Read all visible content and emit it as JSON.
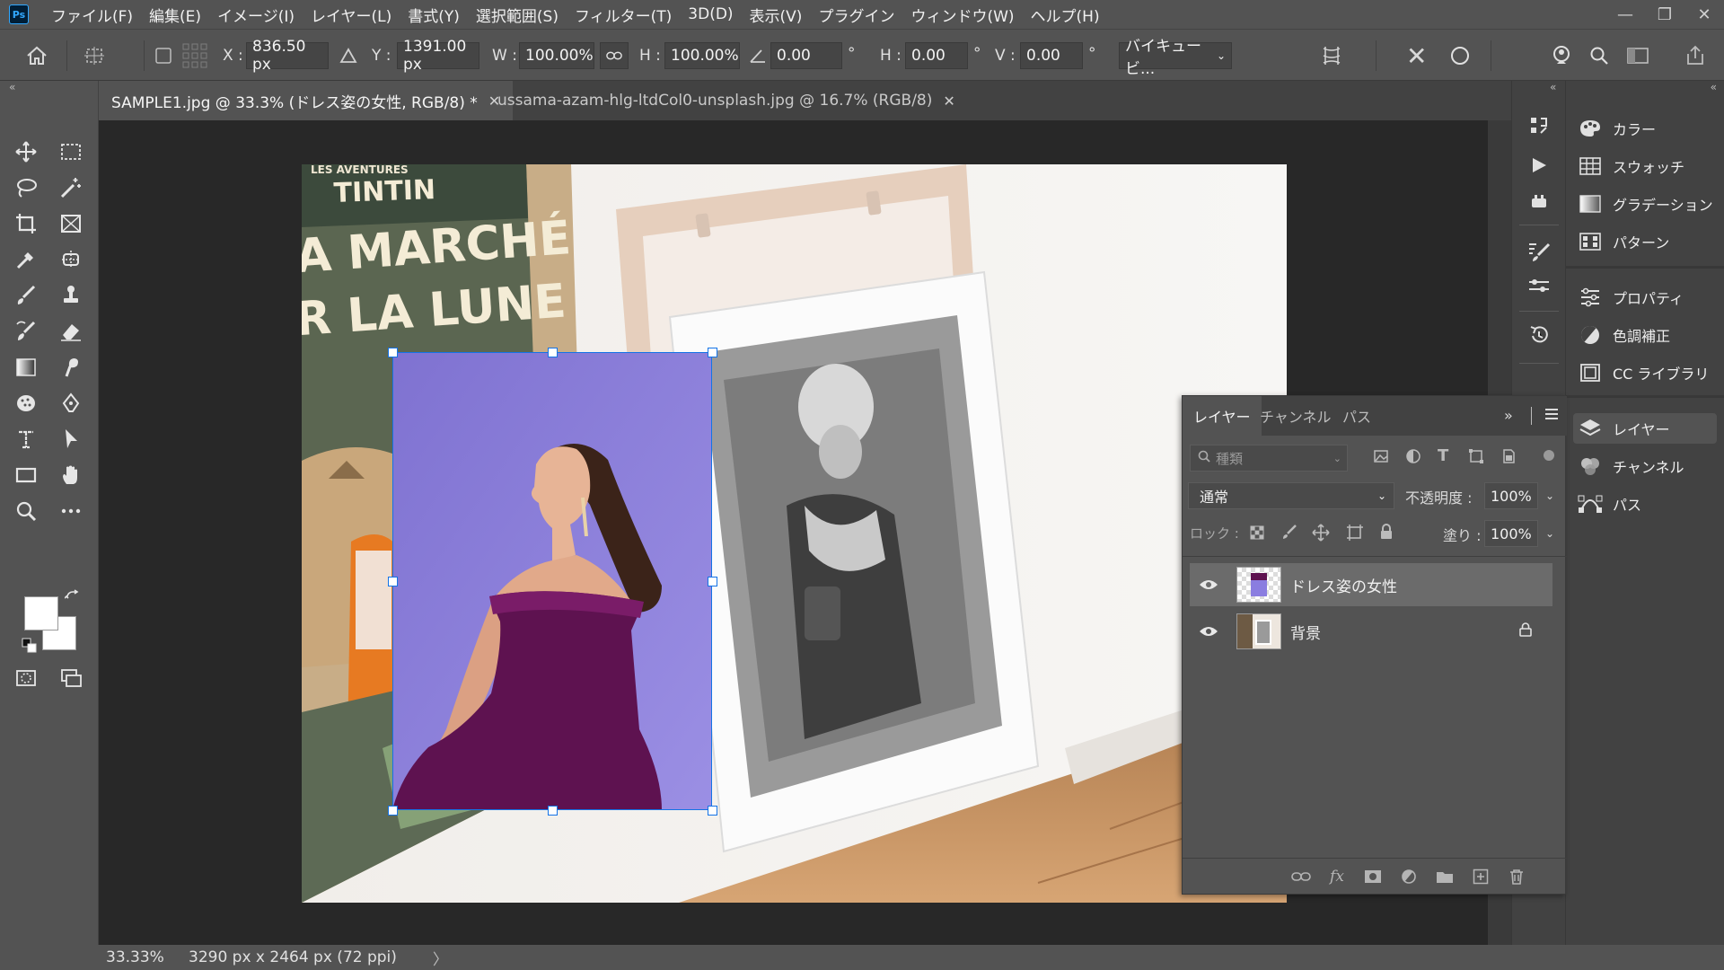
{
  "app": {
    "logo": "Ps",
    "menu": [
      "ファイル(F)",
      "編集(E)",
      "イメージ(I)",
      "レイヤー(L)",
      "書式(Y)",
      "選択範囲(S)",
      "フィルター(T)",
      "3D(D)",
      "表示(V)",
      "プラグイン",
      "ウィンドウ(W)",
      "ヘルプ(H)"
    ]
  },
  "options": {
    "x_label": "X :",
    "x_value": "836.50 px",
    "y_label": "Y :",
    "y_value": "1391.00 px",
    "w_label": "W :",
    "w_value": "100.00%",
    "h_label": "H :",
    "h_value": "100.00%",
    "rotate_value": "0.00",
    "deg": "°",
    "hskew_label": "H :",
    "hskew_value": "0.00",
    "vskew_label": "V :",
    "vskew_value": "0.00",
    "interpolation": "バイキュービ..."
  },
  "tabs": [
    {
      "label": "SAMPLE1.jpg @ 33.3% (ドレス姿の女性, RGB/8) *",
      "active": true
    },
    {
      "label": "ussama-azam-hlg-ltdCol0-unsplash.jpg @ 16.7% (RGB/8)",
      "active": false
    }
  ],
  "canvas": {
    "poster_text": [
      "LES AVENTURES",
      "TINTIN",
      "A MARCHÉ",
      "R LA LUNE"
    ]
  },
  "status": {
    "zoom": "33.33%",
    "doc_info": "3290 px x 2464 px (72 ppi)",
    "arrow": "〉"
  },
  "right_panels": [
    {
      "label": "カラー",
      "icon": "palette-icon"
    },
    {
      "label": "スウォッチ",
      "icon": "swatches-icon"
    },
    {
      "label": "グラデーション",
      "icon": "gradient-icon"
    },
    {
      "label": "パターン",
      "icon": "pattern-icon"
    },
    {
      "label": "プロパティ",
      "icon": "properties-icon"
    },
    {
      "label": "色調補正",
      "icon": "adjustments-icon"
    },
    {
      "label": "CC ライブラリ",
      "icon": "libraries-icon"
    },
    {
      "label": "レイヤー",
      "icon": "layers-icon"
    },
    {
      "label": "チャンネル",
      "icon": "channels-icon"
    },
    {
      "label": "パス",
      "icon": "paths-icon"
    }
  ],
  "layers_panel": {
    "tabs": [
      "レイヤー",
      "チャンネル",
      "パス"
    ],
    "filter_placeholder": "種類",
    "blend_mode": "通常",
    "opacity_label": "不透明度 :",
    "opacity_value": "100%",
    "lock_label": "ロック :",
    "fill_label": "塗り :",
    "fill_value": "100%",
    "layers": [
      {
        "name": "ドレス姿の女性",
        "selected": true,
        "visible": true,
        "locked": false
      },
      {
        "name": "背景",
        "selected": false,
        "visible": true,
        "locked": true
      }
    ]
  },
  "colors": {
    "ui_bg": "#535353",
    "ui_dark": "#424242",
    "canvas_bg": "#282828",
    "selection": "#1473e6",
    "photo_bg": "#8f84d8",
    "dress": "#5e1250"
  }
}
